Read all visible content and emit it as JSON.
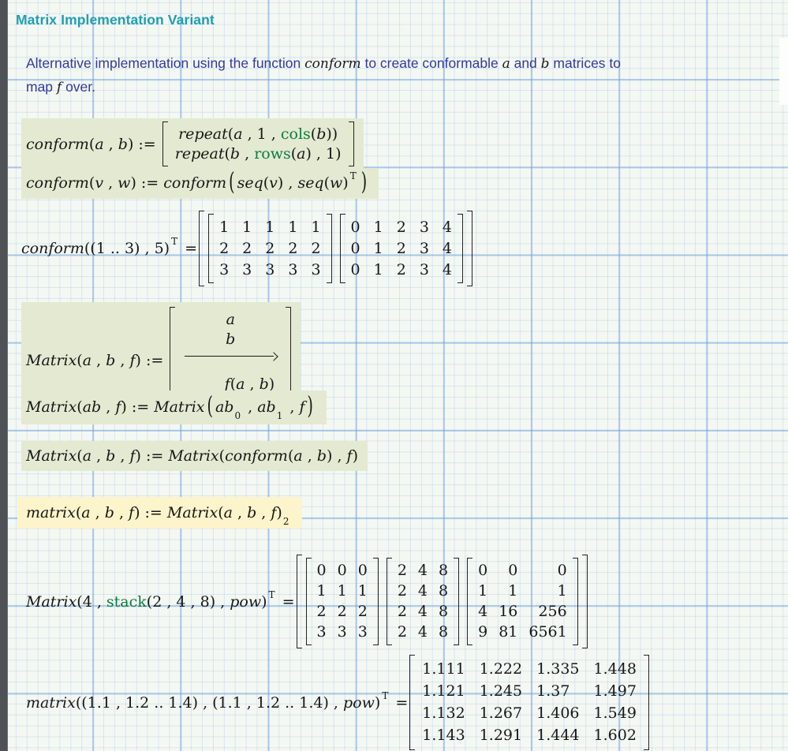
{
  "page": {
    "title": "Matrix Implementation Variant"
  },
  "colors": {
    "title_teal": "#1d9fb2",
    "body_text_indigo": "#323a9e",
    "function_green": "#0c7c3c",
    "highlight_green": "#e4e9d2",
    "highlight_yellow": "#fcf4ca",
    "margin_strip_gray": "#4e5257",
    "grid_line_blue": "#bcd5f0"
  },
  "intro": {
    "line1": [
      {
        "c": "t",
        "t": "Alternative implementation using the function "
      },
      {
        "c": "ti",
        "t": "conform"
      },
      {
        "c": "t",
        "t": " to create conformable "
      },
      {
        "c": "ti",
        "t": "a"
      },
      {
        "c": "t",
        "t": " and "
      },
      {
        "c": "ti",
        "t": "b"
      },
      {
        "c": "t",
        "t": " matrices to"
      }
    ],
    "line2": [
      {
        "c": "t",
        "t": "map "
      },
      {
        "c": "ti",
        "t": "f"
      },
      {
        "c": "t",
        "t": " over."
      }
    ]
  },
  "regions": {
    "conform_def": {
      "head": [
        {
          "c": "i",
          "t": "conform"
        },
        {
          "c": "n",
          "t": "("
        },
        {
          "c": "i",
          "t": "a"
        },
        {
          "c": "n",
          "t": " , "
        },
        {
          "c": "i",
          "t": "b"
        },
        {
          "c": "n",
          "t": ") := "
        }
      ],
      "row1": [
        {
          "c": "i",
          "t": "repeat"
        },
        {
          "c": "n",
          "t": "("
        },
        {
          "c": "i",
          "t": "a"
        },
        {
          "c": "n",
          "t": " , 1 , "
        },
        {
          "c": "g",
          "t": "cols"
        },
        {
          "c": "n",
          "t": "("
        },
        {
          "c": "i",
          "t": "b"
        },
        {
          "c": "n",
          "t": "))"
        }
      ],
      "row2": [
        {
          "c": "i",
          "t": "repeat"
        },
        {
          "c": "n",
          "t": "("
        },
        {
          "c": "i",
          "t": "b"
        },
        {
          "c": "n",
          "t": " , "
        },
        {
          "c": "g",
          "t": "rows"
        },
        {
          "c": "n",
          "t": "("
        },
        {
          "c": "i",
          "t": "a"
        },
        {
          "c": "n",
          "t": ") , 1)"
        }
      ]
    },
    "conform_vw": {
      "tokens": [
        {
          "c": "i",
          "t": "conform"
        },
        {
          "c": "n",
          "t": "("
        },
        {
          "c": "i",
          "t": "v"
        },
        {
          "c": "n",
          "t": " , "
        },
        {
          "c": "i",
          "t": "w"
        },
        {
          "c": "n",
          "t": ") := "
        },
        {
          "c": "i",
          "t": "conform"
        },
        {
          "c": "bp",
          "t": "("
        },
        {
          "c": "i",
          "t": "seq"
        },
        {
          "c": "n",
          "t": "("
        },
        {
          "c": "i",
          "t": "v"
        },
        {
          "c": "n",
          "t": ") , "
        },
        {
          "c": "i",
          "t": "seq"
        },
        {
          "c": "n",
          "t": "("
        },
        {
          "c": "i",
          "t": "w"
        },
        {
          "c": "n",
          "t": ")"
        },
        {
          "c": "sup",
          "t": "T"
        },
        {
          "c": "bp",
          "t": ")"
        }
      ]
    },
    "conform_eval": {
      "head": [
        {
          "c": "i",
          "t": "conform"
        },
        {
          "c": "n",
          "t": "((1 .. 3) , 5)"
        },
        {
          "c": "sup",
          "t": "T"
        },
        {
          "c": "n",
          "t": " ="
        }
      ],
      "m1": [
        [
          "1",
          "1",
          "1",
          "1",
          "1"
        ],
        [
          "2",
          "2",
          "2",
          "2",
          "2"
        ],
        [
          "3",
          "3",
          "3",
          "3",
          "3"
        ]
      ],
      "m2": [
        [
          "0",
          "1",
          "2",
          "3",
          "4"
        ],
        [
          "0",
          "1",
          "2",
          "3",
          "4"
        ],
        [
          "0",
          "1",
          "2",
          "3",
          "4"
        ]
      ]
    },
    "Matrix_def": {
      "head": [
        {
          "c": "i",
          "t": "Matrix"
        },
        {
          "c": "n",
          "t": "("
        },
        {
          "c": "i",
          "t": "a"
        },
        {
          "c": "n",
          "t": " , "
        },
        {
          "c": "i",
          "t": "b"
        },
        {
          "c": "n",
          "t": " , "
        },
        {
          "c": "i",
          "t": "f"
        },
        {
          "c": "n",
          "t": ") := "
        }
      ],
      "row_a": [
        {
          "c": "i",
          "t": "a"
        }
      ],
      "row_b": [
        {
          "c": "i",
          "t": "b"
        }
      ],
      "row_f": [
        {
          "c": "i",
          "t": "f"
        },
        {
          "c": "n",
          "t": "("
        },
        {
          "c": "i",
          "t": "a"
        },
        {
          "c": "n",
          "t": " , "
        },
        {
          "c": "i",
          "t": "b"
        },
        {
          "c": "n",
          "t": ")"
        }
      ]
    },
    "Matrix_ab": {
      "tokens": [
        {
          "c": "i",
          "t": "Matrix"
        },
        {
          "c": "n",
          "t": "("
        },
        {
          "c": "i",
          "t": "ab"
        },
        {
          "c": "n",
          "t": " , "
        },
        {
          "c": "i",
          "t": "f"
        },
        {
          "c": "n",
          "t": ") := "
        },
        {
          "c": "i",
          "t": "Matrix"
        },
        {
          "c": "bp",
          "t": "("
        },
        {
          "c": "i",
          "t": "ab"
        },
        {
          "c": "sub",
          "t": "0"
        },
        {
          "c": "n",
          "t": " , "
        },
        {
          "c": "i",
          "t": "ab"
        },
        {
          "c": "sub",
          "t": "1"
        },
        {
          "c": "n",
          "t": " , "
        },
        {
          "c": "i",
          "t": "f"
        },
        {
          "c": "bp",
          "t": ")"
        }
      ]
    },
    "Matrix_conform": {
      "tokens": [
        {
          "c": "i",
          "t": "Matrix"
        },
        {
          "c": "n",
          "t": "("
        },
        {
          "c": "i",
          "t": "a"
        },
        {
          "c": "n",
          "t": " , "
        },
        {
          "c": "i",
          "t": "b"
        },
        {
          "c": "n",
          "t": " , "
        },
        {
          "c": "i",
          "t": "f"
        },
        {
          "c": "n",
          "t": ") := "
        },
        {
          "c": "i",
          "t": "Matrix"
        },
        {
          "c": "n",
          "t": "("
        },
        {
          "c": "i",
          "t": "conform"
        },
        {
          "c": "n",
          "t": "("
        },
        {
          "c": "i",
          "t": "a"
        },
        {
          "c": "n",
          "t": " , "
        },
        {
          "c": "i",
          "t": "b"
        },
        {
          "c": "n",
          "t": ") , "
        },
        {
          "c": "i",
          "t": "f"
        },
        {
          "c": "n",
          "t": ")"
        }
      ]
    },
    "matrix_lower": {
      "tokens": [
        {
          "c": "i",
          "t": "matrix"
        },
        {
          "c": "n",
          "t": "("
        },
        {
          "c": "i",
          "t": "a"
        },
        {
          "c": "n",
          "t": " , "
        },
        {
          "c": "i",
          "t": "b"
        },
        {
          "c": "n",
          "t": " , "
        },
        {
          "c": "i",
          "t": "f"
        },
        {
          "c": "n",
          "t": ") := "
        },
        {
          "c": "i",
          "t": "Matrix"
        },
        {
          "c": "n",
          "t": "("
        },
        {
          "c": "i",
          "t": "a"
        },
        {
          "c": "n",
          "t": " , "
        },
        {
          "c": "i",
          "t": "b"
        },
        {
          "c": "n",
          "t": " , "
        },
        {
          "c": "i",
          "t": "f"
        },
        {
          "c": "n",
          "t": ")"
        },
        {
          "c": "sub",
          "t": "2"
        }
      ]
    },
    "Matrix_eval": {
      "head": [
        {
          "c": "i",
          "t": "Matrix"
        },
        {
          "c": "n",
          "t": "(4 , "
        },
        {
          "c": "g",
          "t": "stack"
        },
        {
          "c": "n",
          "t": "(2 , 4 , 8) , "
        },
        {
          "c": "i",
          "t": "pow"
        },
        {
          "c": "n",
          "t": ")"
        },
        {
          "c": "sup",
          "t": "T"
        },
        {
          "c": "n",
          "t": " ="
        }
      ],
      "m1": [
        [
          "0",
          "0",
          "0"
        ],
        [
          "1",
          "1",
          "1"
        ],
        [
          "2",
          "2",
          "2"
        ],
        [
          "3",
          "3",
          "3"
        ]
      ],
      "m2": [
        [
          "2",
          "4",
          "8"
        ],
        [
          "2",
          "4",
          "8"
        ],
        [
          "2",
          "4",
          "8"
        ],
        [
          "2",
          "4",
          "8"
        ]
      ],
      "m3": [
        [
          "0",
          "0",
          "0"
        ],
        [
          "1",
          "1",
          "1"
        ],
        [
          "4",
          "16",
          "256"
        ],
        [
          "9",
          "81",
          "6561"
        ]
      ]
    },
    "matrix_eval": {
      "head": [
        {
          "c": "i",
          "t": "matrix"
        },
        {
          "c": "n",
          "t": "((1.1 , 1.2 .. 1.4) , (1.1 , 1.2 .. 1.4) , "
        },
        {
          "c": "i",
          "t": "pow"
        },
        {
          "c": "n",
          "t": ")"
        },
        {
          "c": "sup",
          "t": "T"
        },
        {
          "c": "n",
          "t": " ="
        }
      ],
      "m": [
        [
          "1.111",
          "1.222",
          "1.335",
          "1.448"
        ],
        [
          "1.121",
          "1.245",
          "1.37",
          "1.497"
        ],
        [
          "1.132",
          "1.267",
          "1.406",
          "1.549"
        ],
        [
          "1.143",
          "1.291",
          "1.444",
          "1.602"
        ]
      ]
    }
  }
}
